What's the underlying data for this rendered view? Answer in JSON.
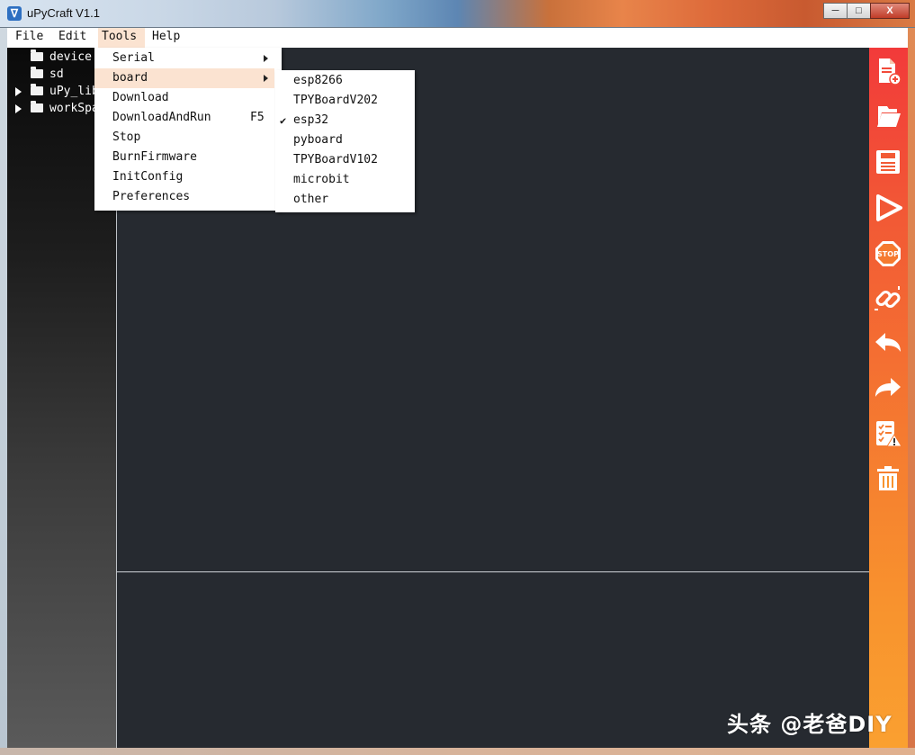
{
  "window": {
    "title": "uPyCraft V1.1",
    "app_icon": "upycraft-logo",
    "controls": {
      "minimize": "─",
      "maximize": "□",
      "close": "X"
    }
  },
  "menubar": {
    "items": [
      {
        "label": "File"
      },
      {
        "label": "Edit"
      },
      {
        "label": "Tools",
        "active": true
      },
      {
        "label": "Help"
      }
    ]
  },
  "sidebar": {
    "tree": [
      {
        "label": "device",
        "expandable": false
      },
      {
        "label": "sd",
        "expandable": false
      },
      {
        "label": "uPy_lib",
        "expandable": true
      },
      {
        "label": "workSpace",
        "expandable": true
      }
    ]
  },
  "tools_menu": {
    "items": [
      {
        "label": "Serial",
        "submenu": true,
        "shortcut": ""
      },
      {
        "label": "board",
        "submenu": true,
        "shortcut": "",
        "highlighted": true
      },
      {
        "label": "Download",
        "submenu": false,
        "shortcut": ""
      },
      {
        "label": "DownloadAndRun",
        "submenu": false,
        "shortcut": "F5"
      },
      {
        "label": "Stop",
        "submenu": false,
        "shortcut": ""
      },
      {
        "label": "BurnFirmware",
        "submenu": false,
        "shortcut": ""
      },
      {
        "label": "InitConfig",
        "submenu": false,
        "shortcut": ""
      },
      {
        "label": "Preferences",
        "submenu": false,
        "shortcut": ""
      }
    ]
  },
  "board_menu": {
    "check_mark": "✔",
    "items": [
      {
        "label": "esp8266",
        "checked": false
      },
      {
        "label": "TPYBoardV202",
        "checked": false
      },
      {
        "label": "esp32",
        "checked": true
      },
      {
        "label": "pyboard",
        "checked": false
      },
      {
        "label": "TPYBoardV102",
        "checked": false
      },
      {
        "label": "microbit",
        "checked": false
      },
      {
        "label": "other",
        "checked": false
      }
    ]
  },
  "toolbar": {
    "buttons": [
      {
        "name": "new-file-icon"
      },
      {
        "name": "open-folder-icon"
      },
      {
        "name": "save-icon"
      },
      {
        "name": "run-icon"
      },
      {
        "name": "stop-icon",
        "label": "STOP"
      },
      {
        "name": "connect-icon"
      },
      {
        "name": "undo-icon"
      },
      {
        "name": "redo-icon"
      },
      {
        "name": "syntax-check-icon"
      },
      {
        "name": "clear-icon"
      }
    ]
  },
  "watermark": {
    "text": "头条 @老爸DIY"
  },
  "colors": {
    "editor_bg": "#262a30",
    "menu_highlight": "#fbe3d1",
    "toolbar_top": "#f23a3a",
    "toolbar_bottom": "#faa030"
  }
}
